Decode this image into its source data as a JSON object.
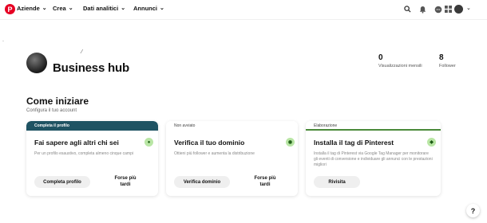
{
  "nav": {
    "logo_letter": "P",
    "menus": [
      {
        "label": "Aziende"
      },
      {
        "label": "Crea"
      },
      {
        "label": "Dati analitici"
      },
      {
        "label": "Annunci"
      }
    ]
  },
  "topbar_icons": [
    "search-icon",
    "bell-icon",
    "chat-icon",
    "apps-grid-icon",
    "avatar",
    "chevron-down-icon"
  ],
  "profile": {
    "title": "Business hub",
    "stats": [
      {
        "value": "0",
        "label": "Visualizzazioni mensili"
      },
      {
        "value": "8",
        "label": "Follower"
      }
    ]
  },
  "getting_started": {
    "title": "Come iniziare",
    "subtitle": "Configura il tuo account",
    "cards": [
      {
        "status": "Completa il profilo",
        "title": "Fai sapere agli altri chi sei",
        "text": "Per un profilo esaustivo, completa almeno cinque campi",
        "primary": "Completa profilo",
        "secondary": "Forse più tardi",
        "accent": "#1f5363"
      },
      {
        "status": "Non avviato",
        "title": "Verifica il tuo dominio",
        "text": "Ottieni più follower e aumenta la distribuzione",
        "primary": "Verifica dominio",
        "secondary": "Forse più tardi"
      },
      {
        "status": "Elaborazione",
        "title": "Installa il tag di Pinterest",
        "text": "Installa il tag di Pinterest via Google Tag Manager per monitorare gli eventi di conversione e individuare gli annunci con le prestazioni migliori",
        "primary": "Rivisita"
      }
    ]
  },
  "help": {
    "label": "?"
  },
  "colors": {
    "brand": "#e60023",
    "status_bar": "#1f5363",
    "badge_bg": "#b9e6a5"
  }
}
